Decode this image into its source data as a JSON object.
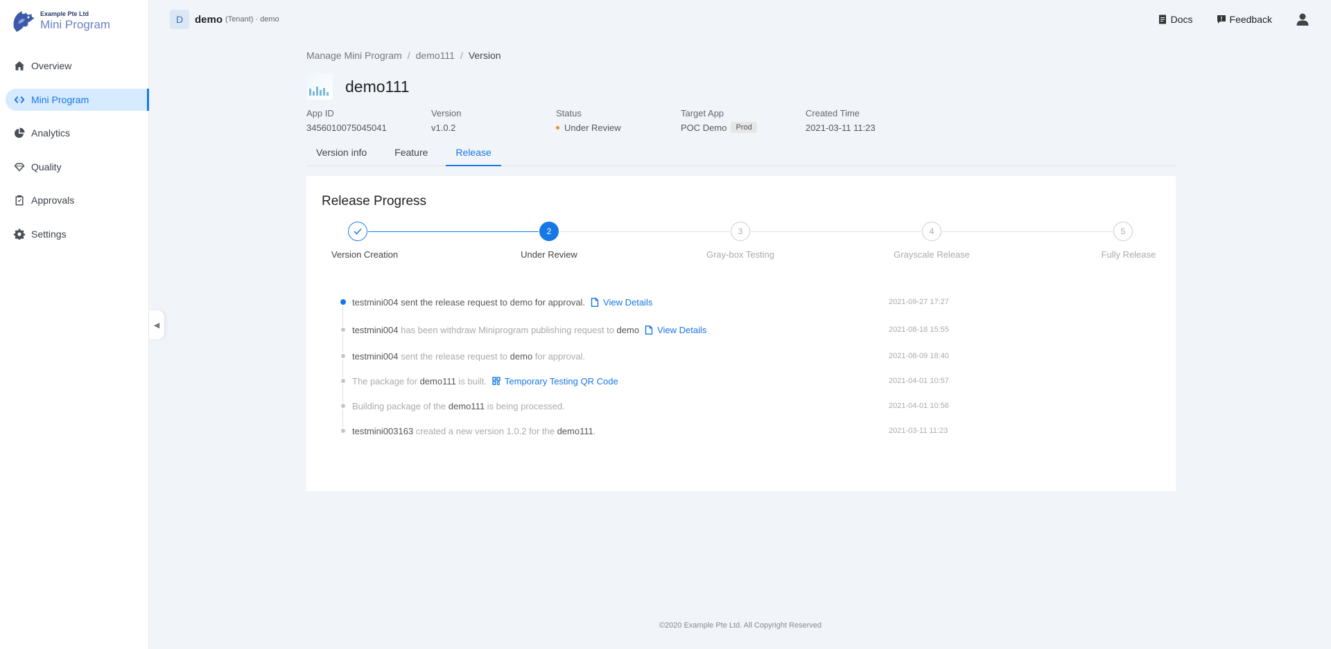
{
  "logo": {
    "company": "Example Pte Ltd",
    "product": "Mini Program"
  },
  "sidebar": {
    "items": [
      {
        "label": "Overview",
        "icon": "home-icon"
      },
      {
        "label": "Mini Program",
        "icon": "code-icon",
        "active": true
      },
      {
        "label": "Analytics",
        "icon": "pie-chart-icon"
      },
      {
        "label": "Quality",
        "icon": "diamond-icon"
      },
      {
        "label": "Approvals",
        "icon": "clipboard-icon"
      },
      {
        "label": "Settings",
        "icon": "gear-icon"
      }
    ]
  },
  "header": {
    "tenant_initial": "D",
    "tenant_name": "demo",
    "tenant_meta": "(Tenant) · demo",
    "docs_label": "Docs",
    "feedback_label": "Feedback"
  },
  "breadcrumb": [
    "Manage Mini Program",
    "demo111",
    "Version"
  ],
  "app": {
    "name": "demo111"
  },
  "meta": [
    {
      "label": "App ID",
      "value": "3456010075045041"
    },
    {
      "label": "Version",
      "value": "v1.0.2"
    },
    {
      "label": "Status",
      "value": "Under Review"
    },
    {
      "label": "Target App",
      "value": "POC Demo",
      "tag": "Prod"
    },
    {
      "label": "Created Time",
      "value": "2021-03-11 11:23"
    }
  ],
  "tabs": [
    {
      "label": "Version info"
    },
    {
      "label": "Feature"
    },
    {
      "label": "Release",
      "active": true
    }
  ],
  "card": {
    "title": "Release Progress"
  },
  "steps": [
    {
      "num": "1",
      "label": "Version Creation",
      "state": "done"
    },
    {
      "num": "2",
      "label": "Under Review",
      "state": "active"
    },
    {
      "num": "3",
      "label": "Gray-box Testing",
      "state": "pending"
    },
    {
      "num": "4",
      "label": "Grayscale Release",
      "state": "pending"
    },
    {
      "num": "5",
      "label": "Fully Release",
      "state": "pending"
    }
  ],
  "timeline": [
    {
      "parts": [
        [
          "b",
          "testmini004"
        ],
        [
          "t",
          " sent the release request to "
        ],
        [
          "b",
          "demo"
        ],
        [
          "t",
          " for approval."
        ]
      ],
      "link": "View Details",
      "link_icon": "file-icon",
      "time": "2021-09-27 17:27",
      "current": true
    },
    {
      "parts": [
        [
          "b",
          "testmini004"
        ],
        [
          "t",
          " has been withdraw Miniprogram publishing request to "
        ],
        [
          "b",
          "demo"
        ]
      ],
      "link": "View Details",
      "link_icon": "file-icon",
      "time": "2021-08-18 15:55"
    },
    {
      "parts": [
        [
          "b",
          "testmini004"
        ],
        [
          "t",
          " sent the release request to "
        ],
        [
          "b",
          "demo"
        ],
        [
          "t",
          " for approval."
        ]
      ],
      "time": "2021-08-09 18:40"
    },
    {
      "parts": [
        [
          "t",
          "The package for "
        ],
        [
          "b",
          "demo111"
        ],
        [
          "t",
          " is built."
        ]
      ],
      "link": "Temporary Testing QR Code",
      "link_icon": "qr-code-icon",
      "time": "2021-04-01 10:57"
    },
    {
      "parts": [
        [
          "t",
          "Building package of the "
        ],
        [
          "b",
          "demo111"
        ],
        [
          "t",
          " is being processed."
        ]
      ],
      "time": "2021-04-01 10:56"
    },
    {
      "parts": [
        [
          "b",
          "testmini003163"
        ],
        [
          "t",
          " created a new version 1.0.2 for the "
        ],
        [
          "b",
          "demo111"
        ],
        [
          "t",
          "."
        ]
      ],
      "time": "2021-03-11 11:23"
    }
  ],
  "footer": "©2020 Example Pte Ltd. All Copyright Reserved"
}
